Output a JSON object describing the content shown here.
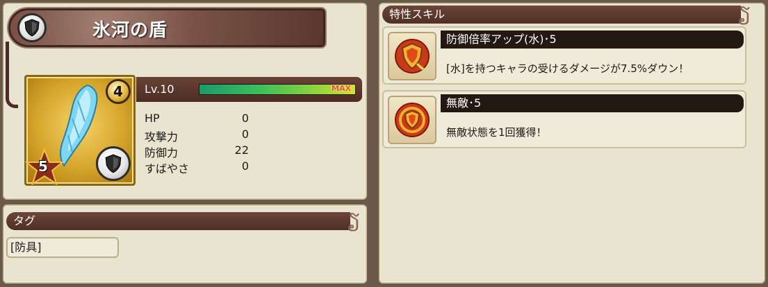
{
  "item": {
    "name": "氷河の盾",
    "rarity": "4",
    "star": "5",
    "level_label": "Lv.10",
    "level_progress": 1.0,
    "max_label": "MAX",
    "type_icon": "shield-icon",
    "image_icon": "ice-shard-icon"
  },
  "stats": [
    {
      "label": "HP",
      "value": "0"
    },
    {
      "label": "攻撃力",
      "value": "0"
    },
    {
      "label": "防御力",
      "value": "22"
    },
    {
      "label": "すばやさ",
      "value": "0"
    }
  ],
  "tags": {
    "header": "タグ",
    "items": [
      "[防具]"
    ]
  },
  "skills": {
    "header": "特性スキル",
    "items": [
      {
        "name": "防御倍率アップ(水)･5",
        "desc": "[水]を持つキャラの受けるダメージが7.5%ダウン！",
        "icon": "defense-up-icon"
      },
      {
        "name": "無敵･5",
        "desc": "無敵状態を1回獲得！",
        "icon": "invincible-icon"
      }
    ]
  },
  "colors": {
    "panel": "#e9e4cf",
    "ribbon": "#5a372d",
    "xp": "#3fc05a",
    "max": "#ff4a3a"
  }
}
